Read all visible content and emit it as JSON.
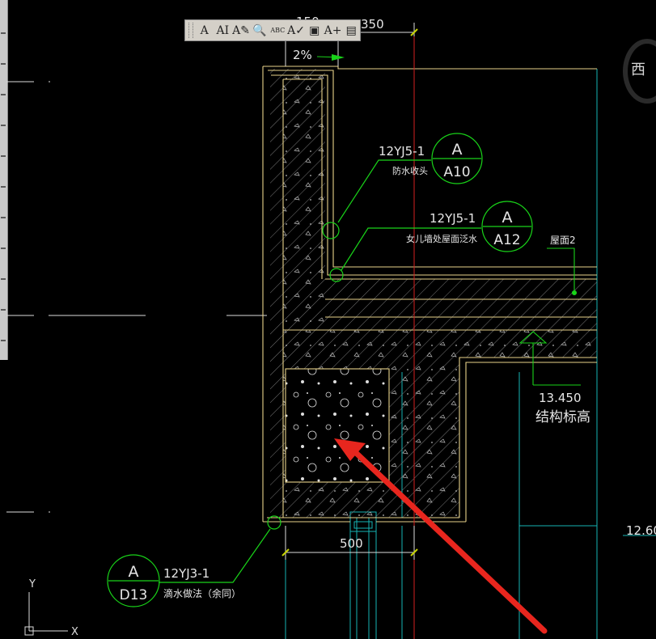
{
  "toolbar": {
    "buttons": [
      {
        "icon": "text-single-line-icon",
        "glyph": "A"
      },
      {
        "icon": "text-multiline-icon",
        "glyph": "AI"
      },
      {
        "icon": "text-edit-icon",
        "glyph": "A✎"
      },
      {
        "icon": "find-replace-icon",
        "glyph": "🔍"
      },
      {
        "icon": "spell-check-icon",
        "glyph": "ABC"
      },
      {
        "icon": "text-style-icon",
        "glyph": "A✓"
      },
      {
        "icon": "text-scale-icon",
        "glyph": "▣"
      },
      {
        "icon": "text-justify-icon",
        "glyph": "A+"
      },
      {
        "icon": "text-frame-icon",
        "glyph": "▤"
      }
    ]
  },
  "compass": {
    "label": "西"
  },
  "drawing": {
    "dim_top_a": "150",
    "dim_top_b": "350",
    "slope": "2%",
    "callout_a10": {
      "ref": "12YJ5-1",
      "desc": "防水收头",
      "top": "A",
      "bottom": "A10"
    },
    "callout_a12": {
      "ref": "12YJ5-1",
      "desc": "女儿墙处屋面泛水",
      "top": "A",
      "bottom": "A12"
    },
    "roof_label": "屋面2",
    "elevation": {
      "value": "13.450",
      "label": "结构标高"
    },
    "elevation_right": "12.60",
    "dim_bottom": "500",
    "callout_d13": {
      "ref": "12YJ3-1",
      "desc": "滴水做法（余同）",
      "top": "A",
      "bottom": "D13"
    },
    "ucs": {
      "y": "Y",
      "x": "X"
    }
  },
  "colors": {
    "background": "#000000",
    "outline": "#e8d28a",
    "concrete": "#ffffff",
    "hatch": "#8a8a8a",
    "leader": "#19d319",
    "centerline": "#d42020",
    "grid": "#16b3b3",
    "arrow": "#e8261e"
  }
}
